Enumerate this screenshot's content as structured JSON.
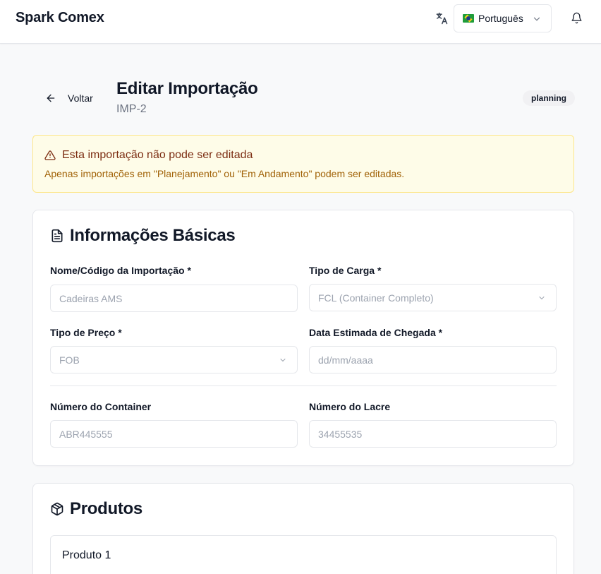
{
  "app": {
    "title": "Spark Comex"
  },
  "header": {
    "language_label": "🇧🇷 Português",
    "language_text": "Português",
    "icons": [
      "translate-icon",
      "chevron-down-icon",
      "bell-icon"
    ]
  },
  "page": {
    "back_label": "Voltar",
    "title": "Editar Importação",
    "subtitle": "IMP-2",
    "status": "planning"
  },
  "alert": {
    "title": "Esta importação não pode ser editada",
    "description": "Apenas importações em \"Planejamento\" ou \"Em Andamento\" podem ser editadas.",
    "icon": "alert-triangle-icon"
  },
  "basic_info": {
    "title": "Informações Básicas",
    "icon": "file-text-icon",
    "fields": {
      "name": {
        "label": "Nome/Código da Importação *",
        "value": "Cadeiras AMS"
      },
      "cargo_type": {
        "label": "Tipo de Carga *",
        "value": "FCL (Container Completo)"
      },
      "price_type": {
        "label": "Tipo de Preço *",
        "value": "FOB"
      },
      "arrival_date": {
        "label": "Data Estimada de Chegada *",
        "placeholder": "dd/mm/aaaa"
      },
      "container_number": {
        "label": "Número do Container",
        "value": "ABR445555"
      },
      "seal_number": {
        "label": "Número do Lacre",
        "value": "34455535"
      }
    }
  },
  "products": {
    "title": "Produtos",
    "icon": "package-icon",
    "items": [
      {
        "title": "Produto 1"
      }
    ]
  },
  "colors": {
    "alert_bg": "#fefce8",
    "alert_border": "#fde68a",
    "alert_title": "#7c2d12",
    "alert_text": "#a16207",
    "badge_bg": "#f1f1f3"
  }
}
